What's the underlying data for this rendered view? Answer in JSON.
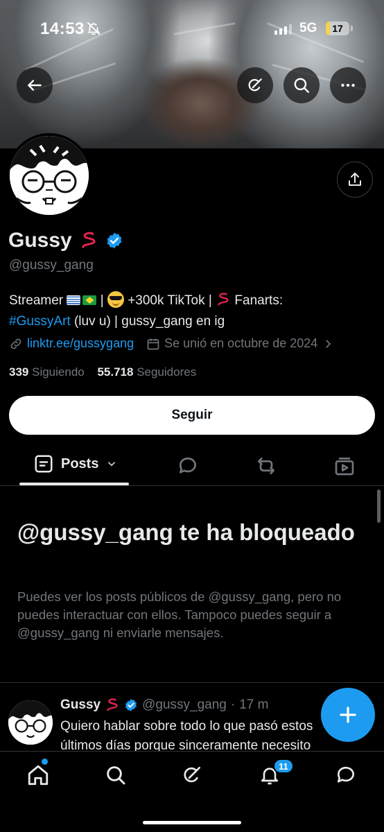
{
  "status_bar": {
    "time": "14:53",
    "network": "5G",
    "battery": "17",
    "battery_level": 0.17
  },
  "profile": {
    "name": "Gussy",
    "handle": "@gussy_gang",
    "bio_part1": "Streamer",
    "bio_part2": "| ",
    "bio_part3": " +300k TikTok | ",
    "bio_part4": " Fanarts: ",
    "bio_hashtag": "#GussyArt",
    "bio_part5": " (luv u) | gussy_gang en ig",
    "link": "linktr.ee/gussygang",
    "joined": "Se unió en octubre de 2024",
    "following_count": "339",
    "following_label": "Siguiendo",
    "followers_count": "55.718",
    "followers_label": "Seguidores",
    "follow_button": "Seguir"
  },
  "tabs": {
    "posts_label": "Posts"
  },
  "blocked": {
    "title": "@gussy_gang te ha bloqueado",
    "description": "Puedes ver los posts públicos de @gussy_gang, pero no puedes interactuar con ellos. Tampoco puedes seguir a @gussy_gang ni enviarle mensajes."
  },
  "post": {
    "name": "Gussy",
    "handle": "@gussy_gang",
    "separator": "·",
    "time": "17 m",
    "text_line1": "Quiero hablar sobre todo lo que pasó estos",
    "text_line2": "últimos días porque sinceramente necesito"
  },
  "bottom_nav": {
    "notifications_badge": "11"
  },
  "colors": {
    "accent": "#1d9bf0",
    "background": "#000000",
    "secondary_text": "#71767b"
  },
  "icons": [
    "back-arrow-icon",
    "grok-icon",
    "search-icon",
    "more-icon",
    "share-icon",
    "verified-icon",
    "link-icon",
    "calendar-icon",
    "chevron-right-icon",
    "posts-icon",
    "chevron-down-icon",
    "reply-icon",
    "repost-icon",
    "video-icon",
    "plus-icon",
    "home-icon",
    "bell-icon",
    "messages-icon",
    "bell-off-icon"
  ]
}
